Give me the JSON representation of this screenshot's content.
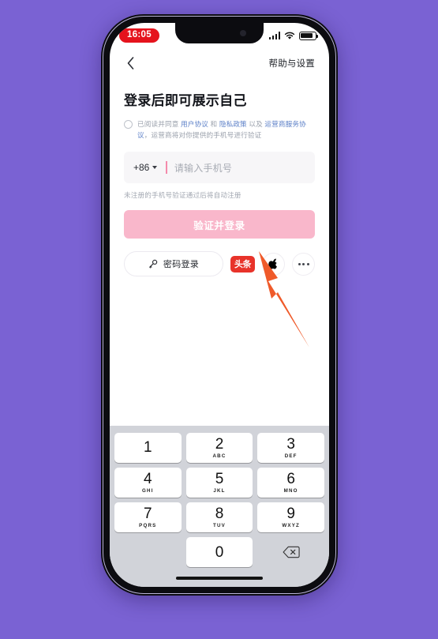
{
  "background": {
    "color": "#7a62d3"
  },
  "status_bar": {
    "time": "16:05",
    "time_badge_color": "#e5131d",
    "signal_icon": "cellular-signal-icon",
    "wifi_icon": "wifi-icon",
    "battery_icon": "battery-icon"
  },
  "nav_bar": {
    "back_icon": "back-chevron-icon",
    "help_label": "帮助与设置"
  },
  "login": {
    "title": "登录后即可展示自己",
    "agreement": {
      "checked": false,
      "prefix": "已阅读并同意 ",
      "link1": "用户协议",
      "mid1": " 和 ",
      "link2": "隐私政策",
      "mid2": " 以及 ",
      "link3": "运营商服务协议",
      "suffix": "，运营商将对你提供的手机号进行验证",
      "link_color": "#5b7fc7"
    },
    "phone_field": {
      "country_code": "+86",
      "placeholder": "请输入手机号",
      "value": "",
      "cursor_color": "#f58aab"
    },
    "hint": "未注册的手机号验证通过后将自动注册",
    "submit_label": "验证并登录",
    "submit_color": "#f9b7cb",
    "password_login_label": "密码登录",
    "password_login_icon": "key-icon",
    "social": [
      {
        "name": "toutiao-login-icon",
        "label": "头条",
        "color": "#e8332a"
      },
      {
        "name": "apple-login-icon",
        "label": "",
        "color": "#000000"
      },
      {
        "name": "more-login-options-icon",
        "label": "",
        "color": "#43464d"
      }
    ]
  },
  "keyboard": {
    "rows": [
      [
        {
          "num": "1",
          "sub": ""
        },
        {
          "num": "2",
          "sub": "ABC"
        },
        {
          "num": "3",
          "sub": "DEF"
        }
      ],
      [
        {
          "num": "4",
          "sub": "GHI"
        },
        {
          "num": "5",
          "sub": "JKL"
        },
        {
          "num": "6",
          "sub": "MNO"
        }
      ],
      [
        {
          "num": "7",
          "sub": "PQRS"
        },
        {
          "num": "8",
          "sub": "TUV"
        },
        {
          "num": "9",
          "sub": "WXYZ"
        }
      ],
      [
        {
          "num": "",
          "sub": "",
          "blank": true
        },
        {
          "num": "0",
          "sub": ""
        },
        {
          "num": "",
          "sub": "",
          "icon": "backspace-icon"
        }
      ]
    ]
  },
  "annotation": {
    "arrow_color": "#ef5a2a",
    "arrow_name": "pointer-arrow-annotation"
  }
}
